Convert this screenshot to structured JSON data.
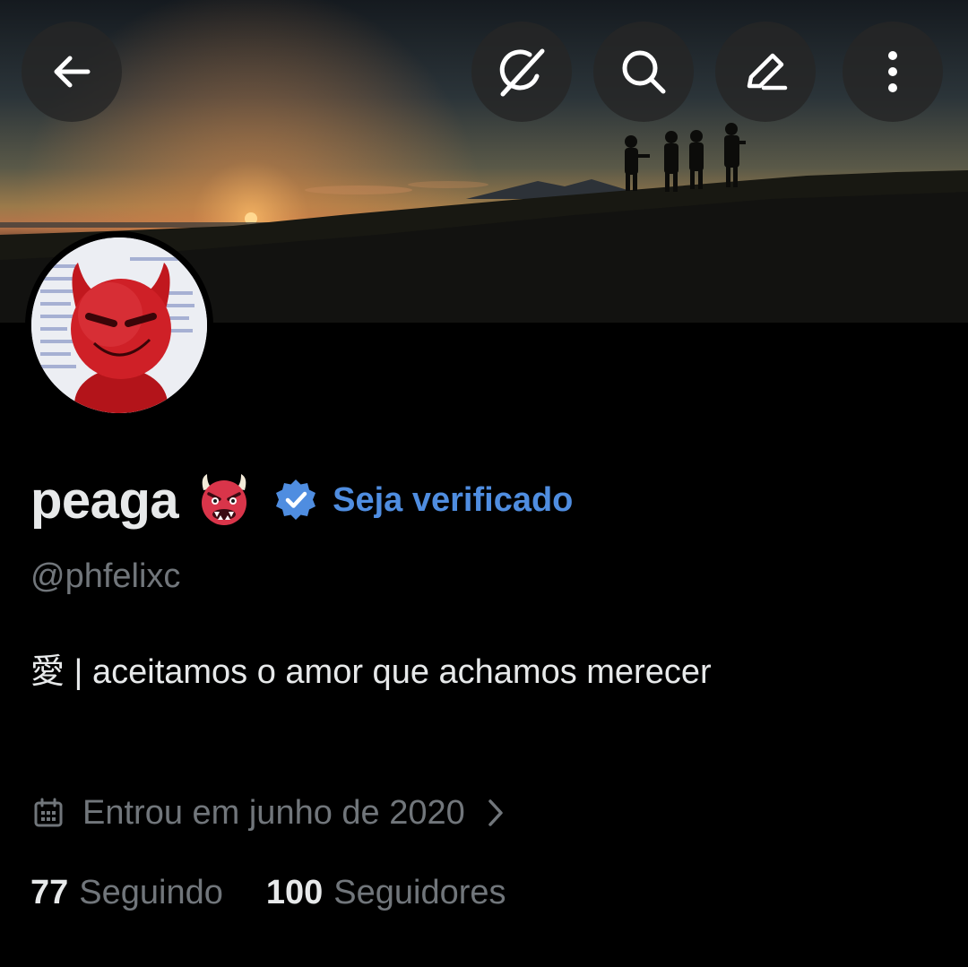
{
  "header": {
    "back_icon": "arrow-left-icon",
    "actions": [
      {
        "name": "grok-icon"
      },
      {
        "name": "search-icon"
      },
      {
        "name": "edit-icon"
      },
      {
        "name": "more-vertical-icon"
      }
    ]
  },
  "profile": {
    "display_name": "peaga",
    "name_emoji": "ogre-emoji",
    "verified_badge_color": "#1d9bf0",
    "verify_cta": "Seja verificado",
    "handle": "@phfelixc",
    "bio": "愛 | aceitamos o amor que achamos merecer",
    "joined": "Entrou em junho de 2020",
    "following_count": "77",
    "following_label": "Seguindo",
    "followers_count": "100",
    "followers_label": "Seguidores"
  },
  "colors": {
    "background": "#000000",
    "primary_text": "#e7e9ea",
    "secondary_text": "#71767b",
    "accent": "#4f8de0"
  }
}
